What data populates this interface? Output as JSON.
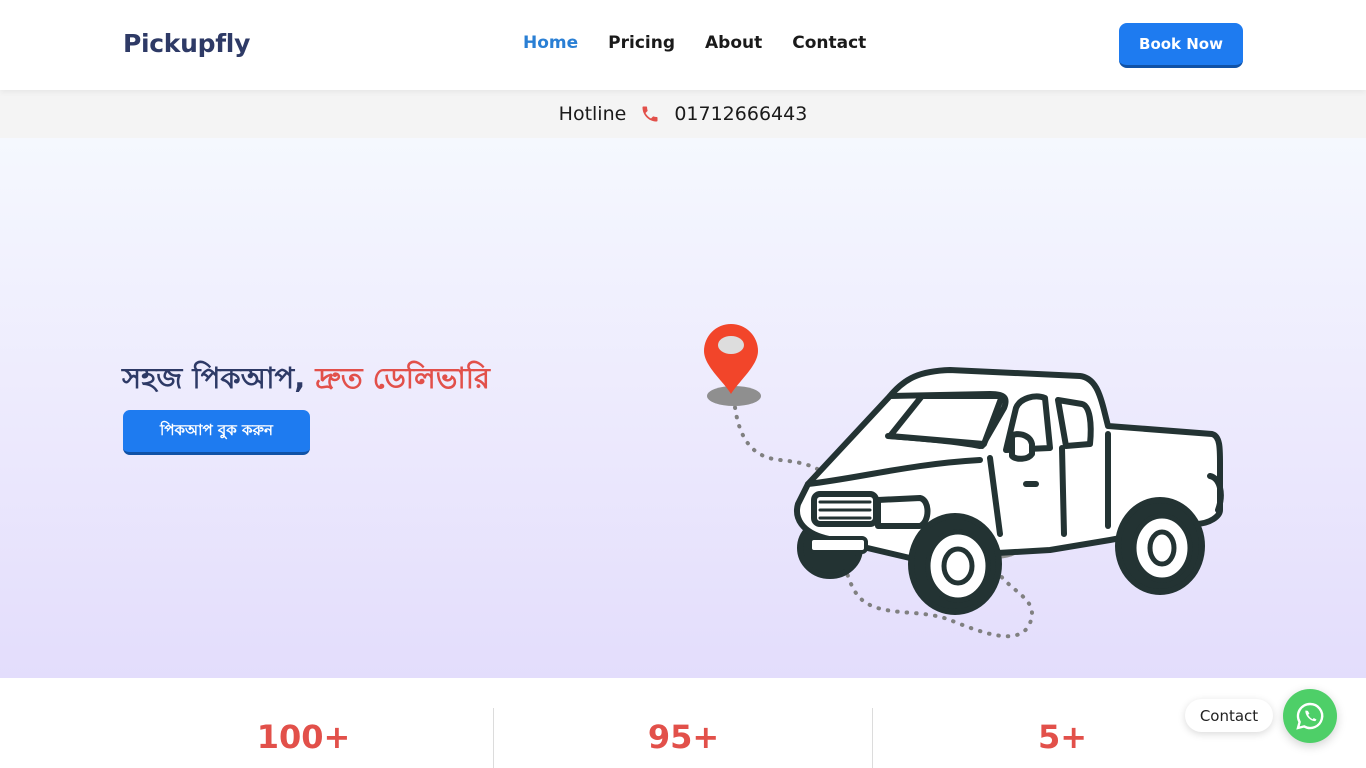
{
  "brand": "Pickupfly",
  "nav": {
    "items": [
      "Home",
      "Pricing",
      "About",
      "Contact"
    ],
    "active": "Home",
    "cta_label": "Book Now"
  },
  "hotline": {
    "label": "Hotline",
    "number": "01712666443"
  },
  "hero": {
    "title_main": "সহজ পিকআপ,",
    "title_accent": "দ্রুত ডেলিভারি",
    "cta_label": "পিকআপ বুক করুন"
  },
  "stats": [
    {
      "value": "100+"
    },
    {
      "value": "95+"
    },
    {
      "value": "5+"
    }
  ],
  "floating": {
    "contact_label": "Contact"
  },
  "colors": {
    "primary": "#1e7bf0",
    "accent": "#e2504a",
    "brand_text": "#2e3a66",
    "whatsapp": "#4ecf68",
    "pin": "#f2452a"
  },
  "icons": [
    "phone-icon",
    "whatsapp-icon",
    "location-pin-icon"
  ]
}
